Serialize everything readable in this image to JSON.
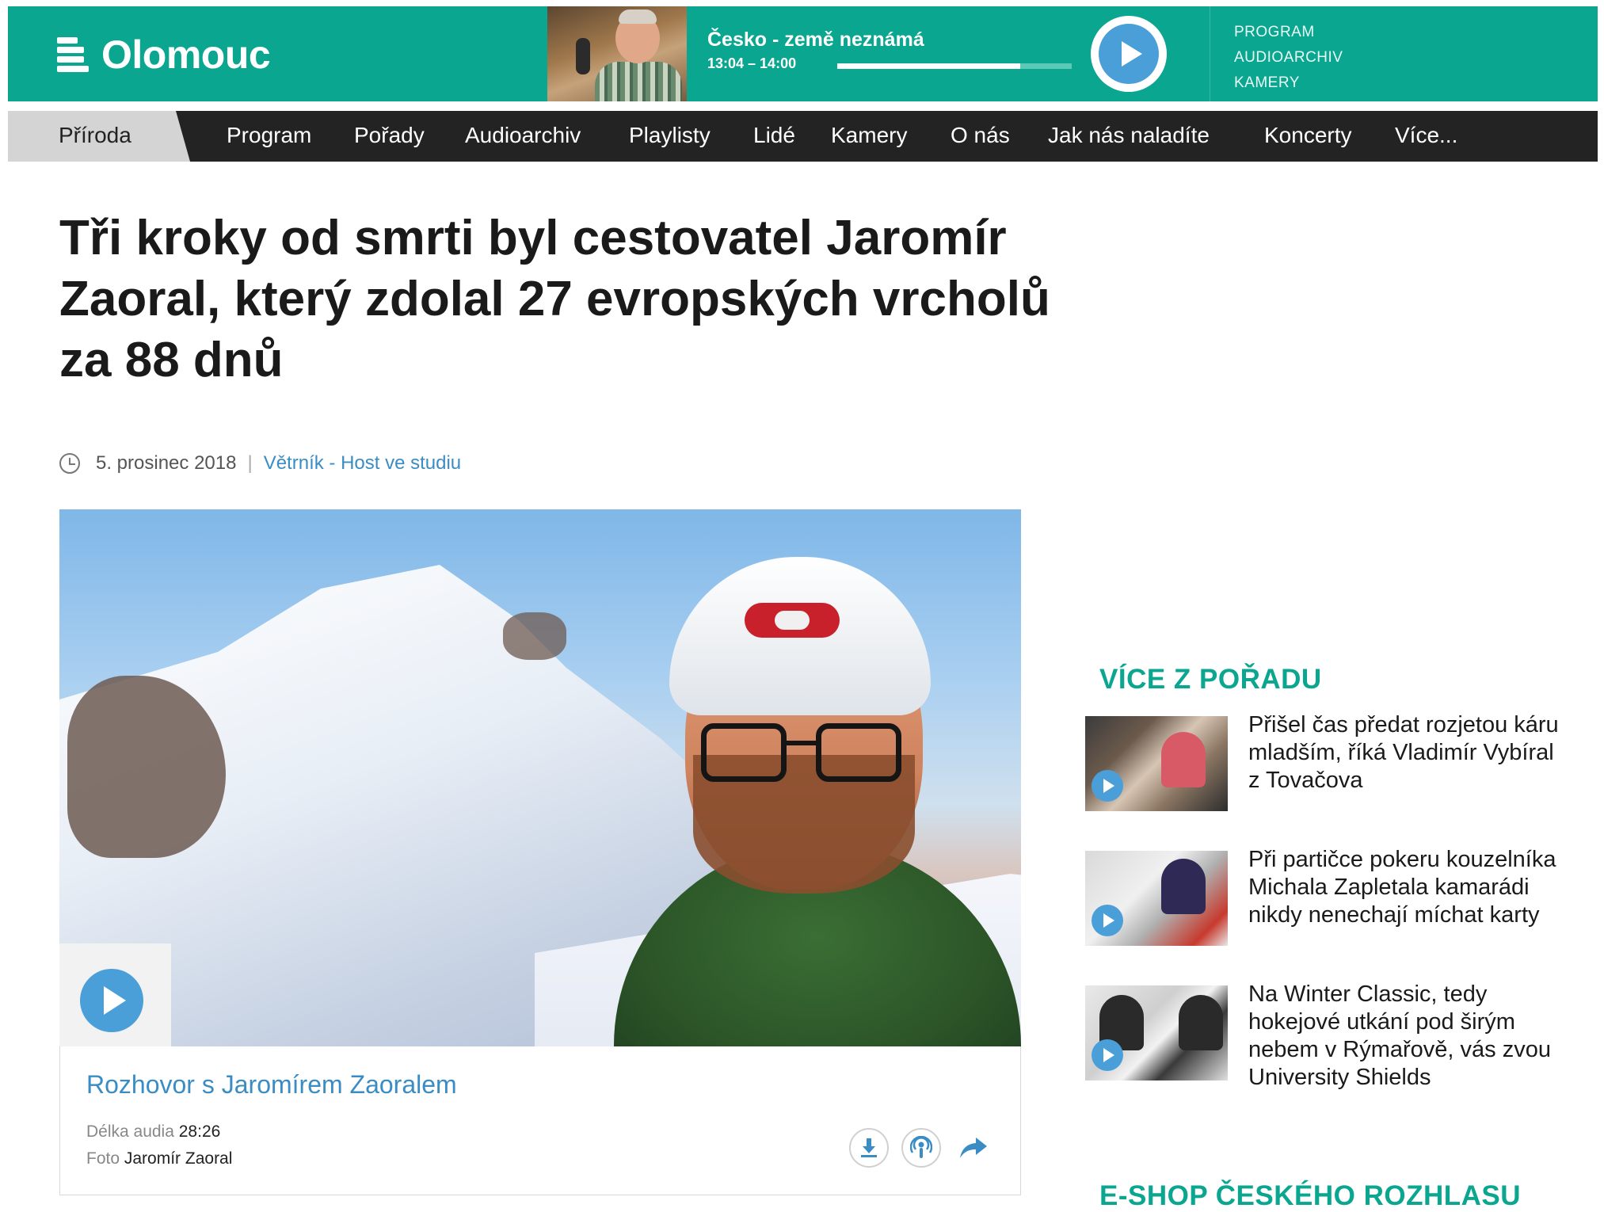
{
  "header": {
    "logo_text": "Olomouc",
    "now_playing": {
      "title": "Česko - země neznámá",
      "time": "13:04 – 14:00",
      "progress_percent": 78
    },
    "links": [
      "PROGRAM",
      "AUDIOARCHIV",
      "KAMERY"
    ],
    "colors": {
      "brand": "#0aa68f",
      "accent": "#4b9fd8",
      "nav_bg": "#232323"
    }
  },
  "nav": {
    "active": "Příroda",
    "items": [
      "Program",
      "Pořady",
      "Audioarchiv",
      "Playlisty",
      "Lidé",
      "Kamery",
      "O nás",
      "Jak nás naladíte",
      "Koncerty",
      "Více..."
    ]
  },
  "article": {
    "title": "Tři kroky od smrti byl cestovatel Jaromír Zaoral, který zdolal 27 evropských vrcholů za 88 dnů",
    "date": "5. prosinec 2018",
    "separator": "|",
    "show": "Větrník - Host ve studiu",
    "audio": {
      "title": "Rozhovor s Jaromírem Zaoralem",
      "length_label": "Délka audia",
      "length_value": "28:26",
      "photo_label": "Foto",
      "photo_value": "Jaromír Zaoral"
    },
    "icons": [
      "clock-icon",
      "play-icon",
      "download-icon",
      "podcast-icon",
      "share-icon"
    ]
  },
  "sidebar": {
    "more_heading": "VÍCE Z POŘADU",
    "items": [
      {
        "text": "Přišel čas předat rozjetou káru mladším, říká Vladimír Vybíral z Tovačova"
      },
      {
        "text": "Při partičce pokeru kouzelníka Michala Zapletala kamarádi nikdy nenechají míchat karty"
      },
      {
        "text": "Na Winter Classic, tedy hokejové utkání pod širým nebem v Rýmařově, vás zvou University Shields"
      }
    ],
    "eshop_heading": "E-SHOP ČESKÉHO ROZHLASU"
  }
}
